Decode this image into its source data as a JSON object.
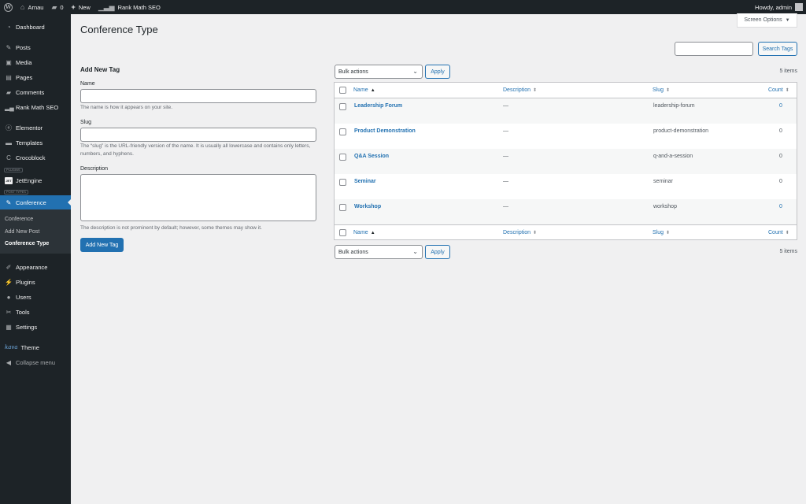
{
  "adminbar": {
    "site_name": "Arnau",
    "comments_count": "0",
    "new_label": "New",
    "rankmath_label": "Rank Math SEO",
    "howdy": "Howdy, admin"
  },
  "sidebar": {
    "dashboard": "Dashboard",
    "posts": "Posts",
    "media": "Media",
    "pages": "Pages",
    "comments": "Comments",
    "rankmath": "Rank Math SEO",
    "elementor": "Elementor",
    "templates": "Templates",
    "crocoblock": "Crocoblock",
    "plugins_sep": "PLUGINS",
    "jetengine": "JetEngine",
    "jet_icon": "JET",
    "post_types_sep": "POST TYPES",
    "conference": "Conference",
    "submenu": [
      "Conference",
      "Add New Post",
      "Conference Type"
    ],
    "appearance": "Appearance",
    "plugins": "Plugins",
    "users": "Users",
    "tools": "Tools",
    "settings": "Settings",
    "kava": "kava",
    "theme": "Theme",
    "collapse": "Collapse menu"
  },
  "page": {
    "title": "Conference Type",
    "screen_options": "Screen Options",
    "search_button": "Search Tags"
  },
  "form": {
    "heading": "Add New Tag",
    "name_label": "Name",
    "name_help": "The name is how it appears on your site.",
    "slug_label": "Slug",
    "slug_help": "The “slug” is the URL-friendly version of the name. It is usually all lowercase and contains only letters, numbers, and hyphens.",
    "desc_label": "Description",
    "desc_help": "The description is not prominent by default; however, some themes may show it.",
    "submit": "Add New Tag"
  },
  "table": {
    "bulk_actions": "Bulk actions",
    "apply": "Apply",
    "items_count": "5 items",
    "columns": {
      "name": "Name",
      "description": "Description",
      "slug": "Slug",
      "count": "Count"
    },
    "rows": [
      {
        "name": "Leadership Forum",
        "description": "—",
        "slug": "leadership-forum",
        "count": "0"
      },
      {
        "name": "Product Demonstration",
        "description": "—",
        "slug": "product-demonstration",
        "count": "0"
      },
      {
        "name": "Q&A Session",
        "description": "—",
        "slug": "q-and-a-session",
        "count": "0"
      },
      {
        "name": "Seminar",
        "description": "—",
        "slug": "seminar",
        "count": "0"
      },
      {
        "name": "Workshop",
        "description": "—",
        "slug": "workshop",
        "count": "0"
      }
    ]
  }
}
